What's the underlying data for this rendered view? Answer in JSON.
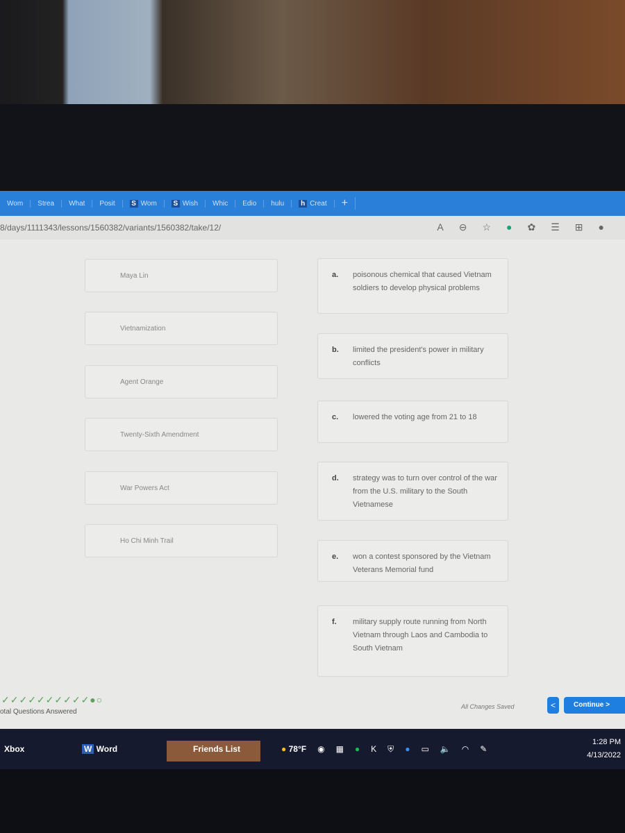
{
  "browser": {
    "tabs": [
      "Wom",
      "Strea",
      "What",
      "Posit",
      "Wom",
      "Wish",
      "Whic",
      "Edio",
      "hulu",
      "Creat"
    ],
    "new_tab": "+",
    "url": "8/days/1111343/lessons/1560382/variants/1560382/take/12/"
  },
  "terms": [
    "Maya Lin",
    "Vietnamization",
    "Agent Orange",
    "Twenty-Sixth Amendment",
    "War Powers Act",
    "Ho Chi Minh Trail"
  ],
  "definitions": [
    {
      "letter": "a.",
      "text": "poisonous chemical that caused Vietnam soldiers to develop physical problems"
    },
    {
      "letter": "b.",
      "text": "limited the president's power in military conflicts"
    },
    {
      "letter": "c.",
      "text": "lowered the voting age from 21 to 18"
    },
    {
      "letter": "d.",
      "text": "strategy was to turn over control of the war from the U.S. military to the South Vietnamese"
    },
    {
      "letter": "e.",
      "text": "won a contest sponsored by the Vietnam Veterans Memorial fund"
    },
    {
      "letter": "f.",
      "text": "military supply route running from North Vietnam through Laos and Cambodia to South Vietnam"
    }
  ],
  "footer": {
    "progress_dots": "✓✓✓✓✓✓✓✓✓✓●○",
    "questions_label": "otal Questions Answered",
    "saved": "All Changes Saved",
    "back": "<",
    "continue": "Continue  >"
  },
  "taskbar": {
    "xbox": "Xbox",
    "word": "Word",
    "friends": "Friends List",
    "weather": "78°F",
    "time": "1:28 PM",
    "date": "4/13/2022"
  }
}
